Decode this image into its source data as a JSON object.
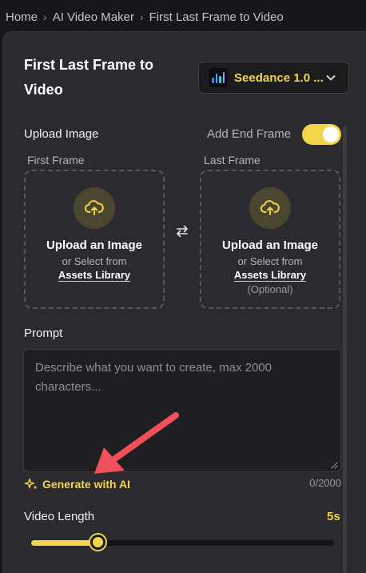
{
  "breadcrumb": {
    "items": [
      "Home",
      "AI Video Maker",
      "First Last Frame to Video"
    ],
    "separator": "›"
  },
  "panel": {
    "title": "First Last Frame to Video"
  },
  "model": {
    "name": "Seedance 1.0 ...",
    "logo_icon": "seedance-logo-icon",
    "dropdown_icon": "chevron-down-icon"
  },
  "upload": {
    "section_label": "Upload Image",
    "toggle_label": "Add End Frame",
    "toggle_on": true,
    "first_frame": {
      "label": "First Frame",
      "title": "Upload an Image",
      "or_text": "or Select from",
      "link": "Assets Library"
    },
    "last_frame": {
      "label": "Last Frame",
      "title": "Upload an Image",
      "or_text": "or Select from",
      "link": "Assets Library",
      "optional": "(Optional)"
    },
    "swap_icon": "swap-icon"
  },
  "prompt": {
    "label": "Prompt",
    "placeholder": "Describe what you want to create, max 2000 characters...",
    "counter": "0/2000",
    "generate_label": "Generate with AI",
    "generate_icon": "sparkle-icon"
  },
  "video_length": {
    "label": "Video Length",
    "value": "5s",
    "slider_fraction": 0.22
  },
  "colors": {
    "accent": "#f2d54b",
    "background": "#17171a",
    "panel": "#2a2a2f",
    "annotation_arrow": "#f0505a"
  }
}
